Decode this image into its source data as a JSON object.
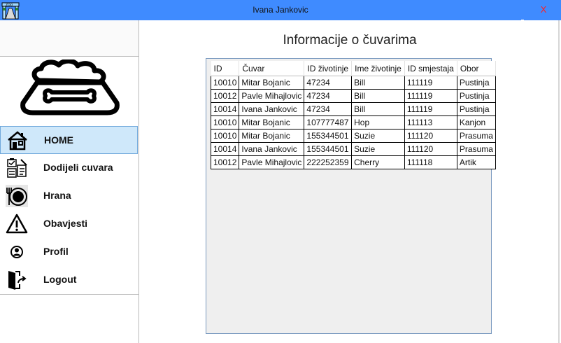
{
  "window": {
    "title": "Ivana Jankovic",
    "close_label": "X",
    "titlebar_color": "#3f8bff"
  },
  "sidebar": {
    "items": [
      {
        "label": "HOME",
        "icon": "home-icon",
        "active": true
      },
      {
        "label": "Dodijeli cuvara",
        "icon": "assign-icon",
        "active": false
      },
      {
        "label": "Hrana",
        "icon": "food-icon",
        "active": false
      },
      {
        "label": "Obavjesti",
        "icon": "warning-icon",
        "active": false
      },
      {
        "label": "Profil",
        "icon": "profile-icon",
        "active": false
      },
      {
        "label": "Logout",
        "icon": "logout-icon",
        "active": false
      }
    ],
    "active_color": "#cfe8fa"
  },
  "main": {
    "title": "Informacije o čuvarima",
    "table": {
      "columns": [
        "ID",
        "Čuvar",
        "ID životinje",
        "Ime životinje",
        "ID smjestaja",
        "Obor"
      ],
      "rows": [
        [
          "10010",
          "Mitar Bojanic",
          "47234",
          "Bill",
          "111119",
          "Pustinja"
        ],
        [
          "10012",
          "Pavle Mihajlovic",
          "47234",
          "Bill",
          "111119",
          "Pustinja"
        ],
        [
          "10014",
          "Ivana Jankovic",
          "47234",
          "Bill",
          "111119",
          "Pustinja"
        ],
        [
          "10010",
          "Mitar Bojanic",
          "107777487",
          "Hop",
          "111113",
          "Kanjon"
        ],
        [
          "10010",
          "Mitar Bojanic",
          "155344501",
          "Suzie",
          "111120",
          "Prasuma"
        ],
        [
          "10014",
          "Ivana Jankovic",
          "155344501",
          "Suzie",
          "111120",
          "Prasuma"
        ],
        [
          "10012",
          "Pavle Mihajlovic",
          "222252359",
          "Cherry",
          "111118",
          "Artik"
        ]
      ]
    }
  }
}
